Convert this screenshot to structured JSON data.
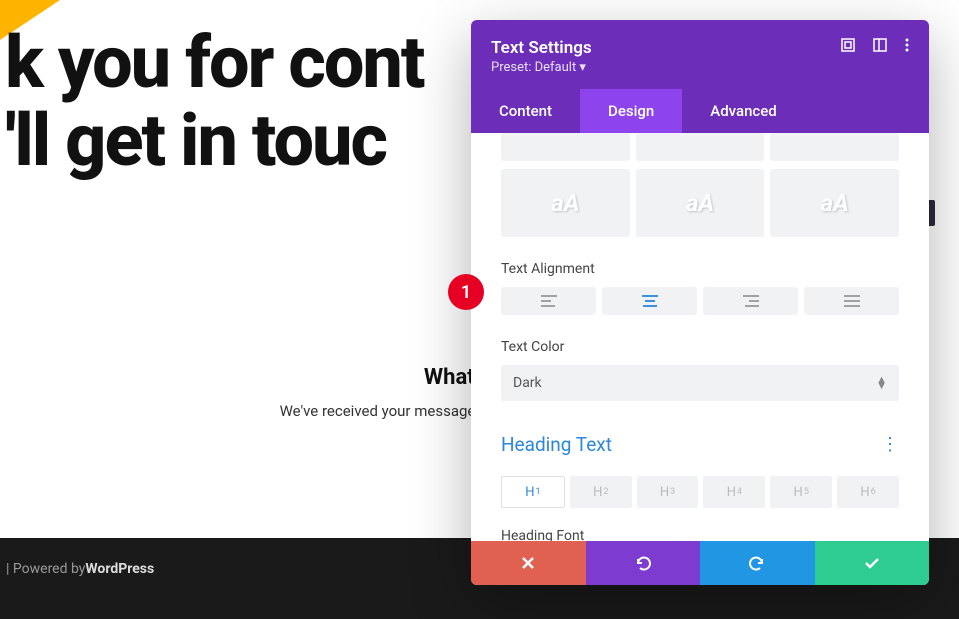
{
  "page": {
    "heading_line1": "k you for cont",
    "heading_line2": "'ll get in touc",
    "whats_next_title": "What's Next",
    "whats_next_body": "We've received your message and we'll send you an email wit"
  },
  "footer": {
    "prefix": " | Powered by ",
    "brand": "WordPress"
  },
  "panel": {
    "title": "Text Settings",
    "preset": "Preset: Default ▾",
    "tabs": {
      "content": "Content",
      "design": "Design",
      "advanced": "Advanced"
    },
    "styles": {
      "sample": "aA"
    },
    "text_alignment_label": "Text Alignment",
    "text_color_label": "Text Color",
    "text_color_value": "Dark",
    "heading_text_label": "Heading Text",
    "h_tabs": [
      "H",
      "H",
      "H",
      "H",
      "H",
      "H"
    ],
    "heading_font_label": "Heading Font"
  },
  "callouts": {
    "c1": "1"
  }
}
